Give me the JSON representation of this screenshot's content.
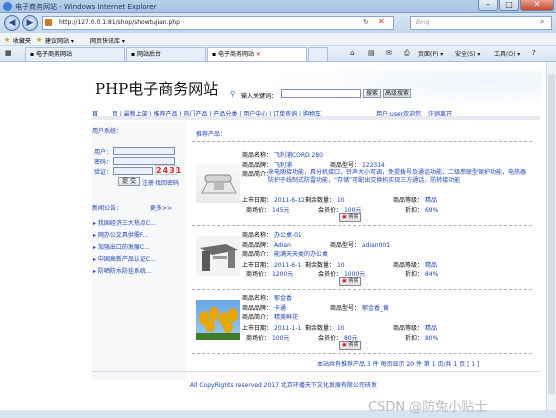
{
  "window": {
    "title": "电子商务网站 - Windows Internet Explorer"
  },
  "browser": {
    "address": "http://127.0.0.1:81/shop/showtujian.php",
    "search_placeholder": "Bing",
    "favorites_label": "收藏夹",
    "favbar_items": [
      "建议网站 ▾",
      "网页快讯库 ▾"
    ],
    "tabs": [
      "电子商务网站",
      "网站后台",
      "电子商务网站"
    ],
    "commands": [
      "页面(P) ▾",
      "安全(S) ▾",
      "工具(O) ▾",
      "?"
    ]
  },
  "site": {
    "title": "PHP电子商务网站",
    "search_label": "输入关键词：",
    "search_button": "搜索",
    "advanced_search_button": "高级搜索",
    "nav": [
      "首",
      "页",
      "最新上架",
      "推荐产品",
      "热门产品",
      "产品分类",
      "用户中心",
      "订单查询",
      "购物车"
    ],
    "welcome": "用户:user欢迎您",
    "logout": "注销离开"
  },
  "login": {
    "header": "用户系统：",
    "username_label": "用户：",
    "password_label": "密码：",
    "captcha_label": "验证：",
    "captcha_value": "2431",
    "submit": "提 交",
    "register": "注册",
    "forgot": "找回密码"
  },
  "notices": {
    "header": "新闻公告：",
    "more": "更多>>",
    "items": [
      "我国经济三大热点C...",
      "网办公文具供需F...",
      "加强出口的发展C...",
      "中国高新产品认证C...",
      "防晒防水防挂系统..."
    ]
  },
  "section_title": "推荐产品：",
  "products": [
    {
      "name": "飞利浦CORD 280",
      "brand": "飞利浦",
      "model": "122314",
      "intro": "来电随接功能，具分机接口，铃声大小可调，免提拨号及通话功能，二级串联型保护功能，电热器防护于线制式防雷功能，“存储”可配出交换机实现三方通话，防转接功能",
      "date": "2011-6-12",
      "stock": "10",
      "grade": "精品",
      "market_price": "145元",
      "member_price": "100元",
      "discount": "69%"
    },
    {
      "name": "办公桌-01",
      "brand": "Adian",
      "model": "adian001",
      "intro": "能满天天类的办公桌",
      "date": "2011-6-1",
      "stock": "10",
      "grade": "精品",
      "market_price": "1200元",
      "member_price": "1000元",
      "discount": "84%"
    },
    {
      "name": "郁金香",
      "brand": "卡通",
      "model": "郁金香_黄",
      "intro": "精美鲜花",
      "date": "2011-1-1",
      "stock": "10",
      "grade": "精品",
      "market_price": "100元",
      "member_price": "80元",
      "discount": "80%"
    }
  ],
  "product_labels": {
    "name": "商品名称：",
    "brand": "商品品牌：",
    "model": "商品型号：",
    "intro": "商品简介：",
    "date": "上市日期：",
    "stock": "剩余数量：",
    "grade": "商品等级：",
    "market_price": "商场价：",
    "member_price": "会员价：",
    "discount": "折扣：",
    "buy": "购买"
  },
  "pagination": "本站共有推荐产品 3 件 每页显示 20 件 第 1 页/共 1 页 [ 1 ]",
  "footer": "All CopyRights reserved 2017 北京环播天下文化发展有限公司研发",
  "watermark": "CSDN @防兔小贴士",
  "colors": {
    "link": "#0a3bb5",
    "chrome": "#c5d8ee",
    "accent_red": "#cc0000"
  }
}
